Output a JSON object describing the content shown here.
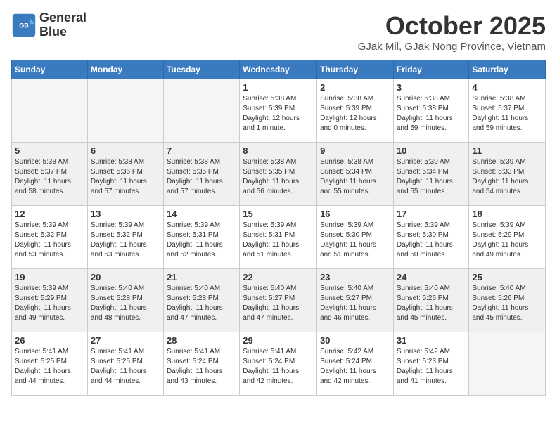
{
  "header": {
    "logo_line1": "General",
    "logo_line2": "Blue",
    "month": "October 2025",
    "location": "GJak Mil, GJak Nong Province, Vietnam"
  },
  "weekdays": [
    "Sunday",
    "Monday",
    "Tuesday",
    "Wednesday",
    "Thursday",
    "Friday",
    "Saturday"
  ],
  "weeks": [
    [
      {
        "day": "",
        "info": ""
      },
      {
        "day": "",
        "info": ""
      },
      {
        "day": "",
        "info": ""
      },
      {
        "day": "1",
        "info": "Sunrise: 5:38 AM\nSunset: 5:39 PM\nDaylight: 12 hours\nand 1 minute."
      },
      {
        "day": "2",
        "info": "Sunrise: 5:38 AM\nSunset: 5:39 PM\nDaylight: 12 hours\nand 0 minutes."
      },
      {
        "day": "3",
        "info": "Sunrise: 5:38 AM\nSunset: 5:38 PM\nDaylight: 11 hours\nand 59 minutes."
      },
      {
        "day": "4",
        "info": "Sunrise: 5:38 AM\nSunset: 5:37 PM\nDaylight: 11 hours\nand 59 minutes."
      }
    ],
    [
      {
        "day": "5",
        "info": "Sunrise: 5:38 AM\nSunset: 5:37 PM\nDaylight: 11 hours\nand 58 minutes."
      },
      {
        "day": "6",
        "info": "Sunrise: 5:38 AM\nSunset: 5:36 PM\nDaylight: 11 hours\nand 57 minutes."
      },
      {
        "day": "7",
        "info": "Sunrise: 5:38 AM\nSunset: 5:35 PM\nDaylight: 11 hours\nand 57 minutes."
      },
      {
        "day": "8",
        "info": "Sunrise: 5:38 AM\nSunset: 5:35 PM\nDaylight: 11 hours\nand 56 minutes."
      },
      {
        "day": "9",
        "info": "Sunrise: 5:38 AM\nSunset: 5:34 PM\nDaylight: 11 hours\nand 55 minutes."
      },
      {
        "day": "10",
        "info": "Sunrise: 5:39 AM\nSunset: 5:34 PM\nDaylight: 11 hours\nand 55 minutes."
      },
      {
        "day": "11",
        "info": "Sunrise: 5:39 AM\nSunset: 5:33 PM\nDaylight: 11 hours\nand 54 minutes."
      }
    ],
    [
      {
        "day": "12",
        "info": "Sunrise: 5:39 AM\nSunset: 5:32 PM\nDaylight: 11 hours\nand 53 minutes."
      },
      {
        "day": "13",
        "info": "Sunrise: 5:39 AM\nSunset: 5:32 PM\nDaylight: 11 hours\nand 53 minutes."
      },
      {
        "day": "14",
        "info": "Sunrise: 5:39 AM\nSunset: 5:31 PM\nDaylight: 11 hours\nand 52 minutes."
      },
      {
        "day": "15",
        "info": "Sunrise: 5:39 AM\nSunset: 5:31 PM\nDaylight: 11 hours\nand 51 minutes."
      },
      {
        "day": "16",
        "info": "Sunrise: 5:39 AM\nSunset: 5:30 PM\nDaylight: 11 hours\nand 51 minutes."
      },
      {
        "day": "17",
        "info": "Sunrise: 5:39 AM\nSunset: 5:30 PM\nDaylight: 11 hours\nand 50 minutes."
      },
      {
        "day": "18",
        "info": "Sunrise: 5:39 AM\nSunset: 5:29 PM\nDaylight: 11 hours\nand 49 minutes."
      }
    ],
    [
      {
        "day": "19",
        "info": "Sunrise: 5:39 AM\nSunset: 5:29 PM\nDaylight: 11 hours\nand 49 minutes."
      },
      {
        "day": "20",
        "info": "Sunrise: 5:40 AM\nSunset: 5:28 PM\nDaylight: 11 hours\nand 48 minutes."
      },
      {
        "day": "21",
        "info": "Sunrise: 5:40 AM\nSunset: 5:28 PM\nDaylight: 11 hours\nand 47 minutes."
      },
      {
        "day": "22",
        "info": "Sunrise: 5:40 AM\nSunset: 5:27 PM\nDaylight: 11 hours\nand 47 minutes."
      },
      {
        "day": "23",
        "info": "Sunrise: 5:40 AM\nSunset: 5:27 PM\nDaylight: 11 hours\nand 46 minutes."
      },
      {
        "day": "24",
        "info": "Sunrise: 5:40 AM\nSunset: 5:26 PM\nDaylight: 11 hours\nand 45 minutes."
      },
      {
        "day": "25",
        "info": "Sunrise: 5:40 AM\nSunset: 5:26 PM\nDaylight: 11 hours\nand 45 minutes."
      }
    ],
    [
      {
        "day": "26",
        "info": "Sunrise: 5:41 AM\nSunset: 5:25 PM\nDaylight: 11 hours\nand 44 minutes."
      },
      {
        "day": "27",
        "info": "Sunrise: 5:41 AM\nSunset: 5:25 PM\nDaylight: 11 hours\nand 44 minutes."
      },
      {
        "day": "28",
        "info": "Sunrise: 5:41 AM\nSunset: 5:24 PM\nDaylight: 11 hours\nand 43 minutes."
      },
      {
        "day": "29",
        "info": "Sunrise: 5:41 AM\nSunset: 5:24 PM\nDaylight: 11 hours\nand 42 minutes."
      },
      {
        "day": "30",
        "info": "Sunrise: 5:42 AM\nSunset: 5:24 PM\nDaylight: 11 hours\nand 42 minutes."
      },
      {
        "day": "31",
        "info": "Sunrise: 5:42 AM\nSunset: 5:23 PM\nDaylight: 11 hours\nand 41 minutes."
      },
      {
        "day": "",
        "info": ""
      }
    ]
  ]
}
